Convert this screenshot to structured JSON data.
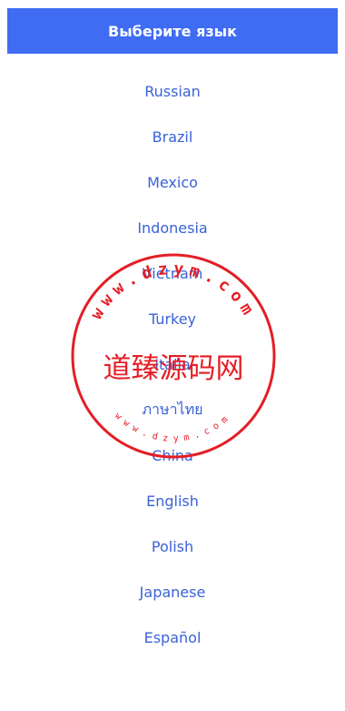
{
  "header": {
    "title": "Выберите язык"
  },
  "languages": [
    {
      "label": "Russian"
    },
    {
      "label": "Brazil"
    },
    {
      "label": "Mexico"
    },
    {
      "label": "Indonesia"
    },
    {
      "label": "Vietnam"
    },
    {
      "label": "Turkey"
    },
    {
      "label": "Italia"
    },
    {
      "label": "ภาษาไทย"
    },
    {
      "label": "China"
    },
    {
      "label": "English"
    },
    {
      "label": "Polish"
    },
    {
      "label": "Japanese"
    },
    {
      "label": "Español"
    }
  ],
  "watermark": {
    "main_text": "道臻源码网",
    "ring_text_top": "www.dzym.com",
    "ring_text_bottom": "www.dzym.com",
    "color": "#e41e26"
  },
  "colors": {
    "header_bg": "#3f6cf3",
    "link": "#3a62d8"
  }
}
